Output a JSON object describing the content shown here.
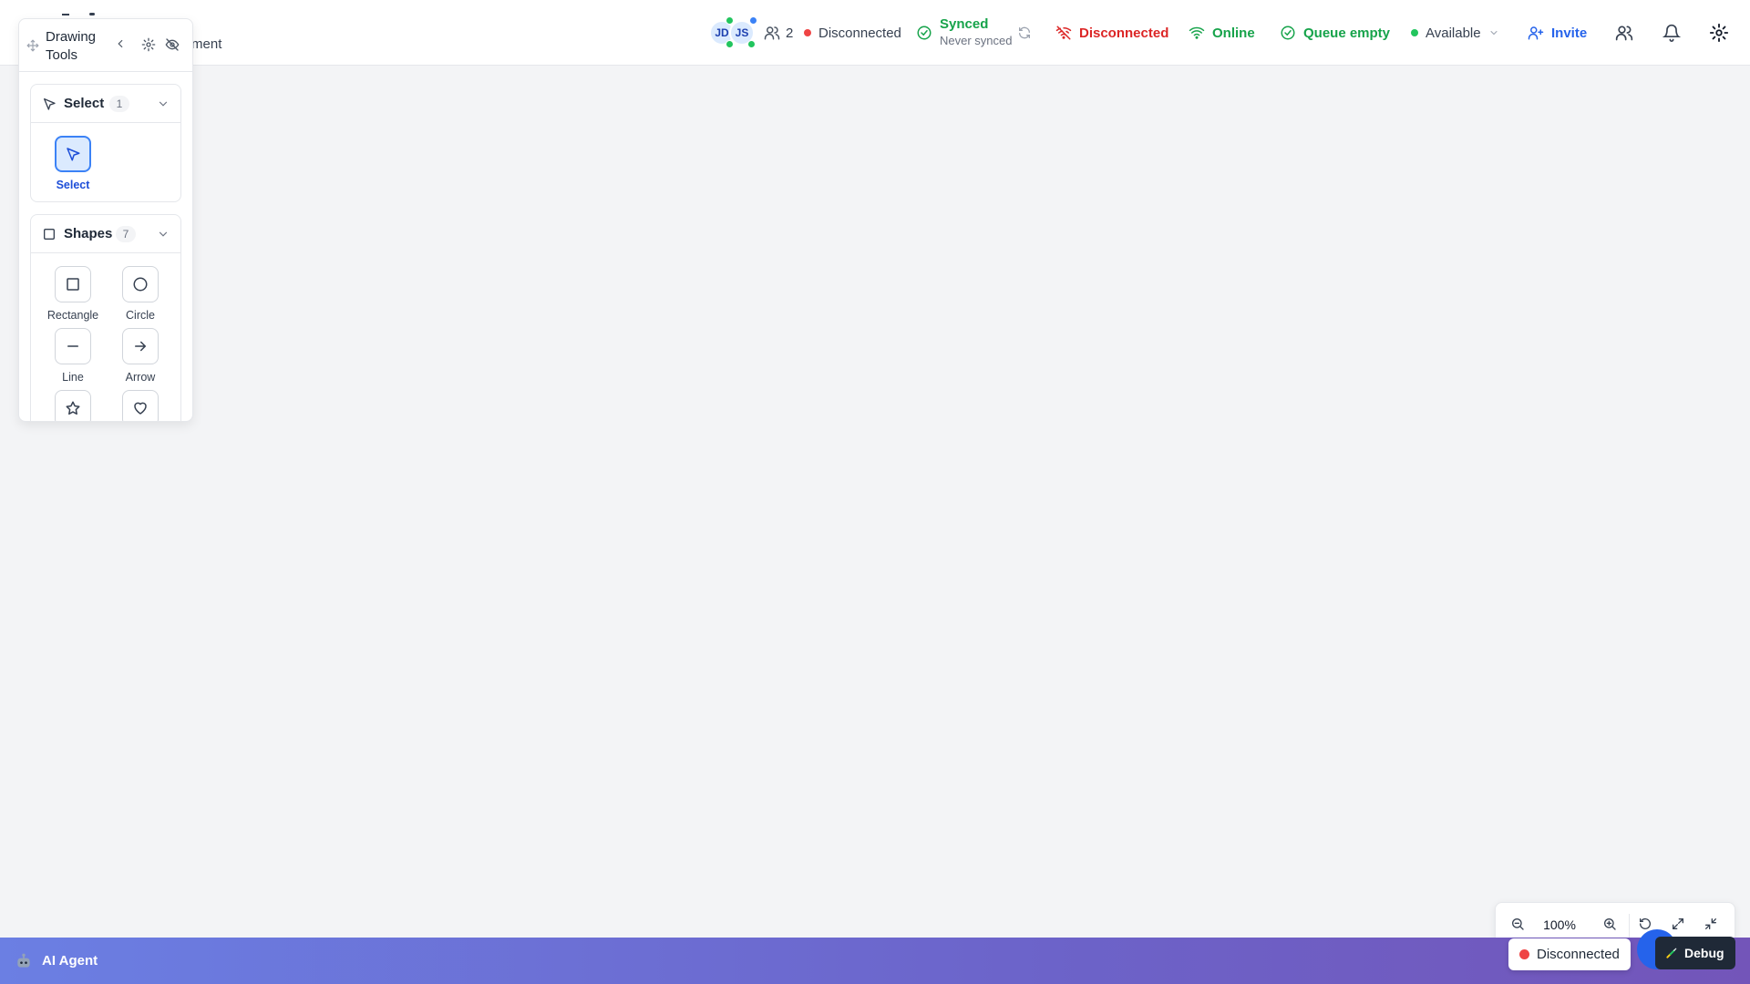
{
  "header": {
    "breadcrumb_fragment": "lopment",
    "avatars": [
      "JD",
      "JS"
    ],
    "users_count": "2",
    "connection_status": "Disconnected",
    "sync": {
      "label": "Synced",
      "sub": "Never synced"
    },
    "server_status": "Disconnected",
    "network_status": "Online",
    "queue_status": "Queue empty",
    "availability": "Available",
    "invite_label": "Invite"
  },
  "drawing_tools": {
    "title": "Drawing Tools",
    "sections": [
      {
        "label": "Select",
        "count": "1",
        "tools": [
          "Select"
        ]
      },
      {
        "label": "Shapes",
        "count": "7",
        "tools": [
          "Rectangle",
          "Circle",
          "Line",
          "Arrow",
          "Star",
          "Heart"
        ]
      }
    ]
  },
  "zoom": {
    "level": "100%"
  },
  "bottom_bar": {
    "agent_label": "AI Agent",
    "toast_status": "Disconnected",
    "debug_label": "Debug"
  },
  "colors": {
    "accent": "#2563eb",
    "success": "#16a34a",
    "danger": "#dc2626",
    "bottom_gradient_start": "#6b7fe3",
    "bottom_gradient_end": "#7355b9"
  }
}
